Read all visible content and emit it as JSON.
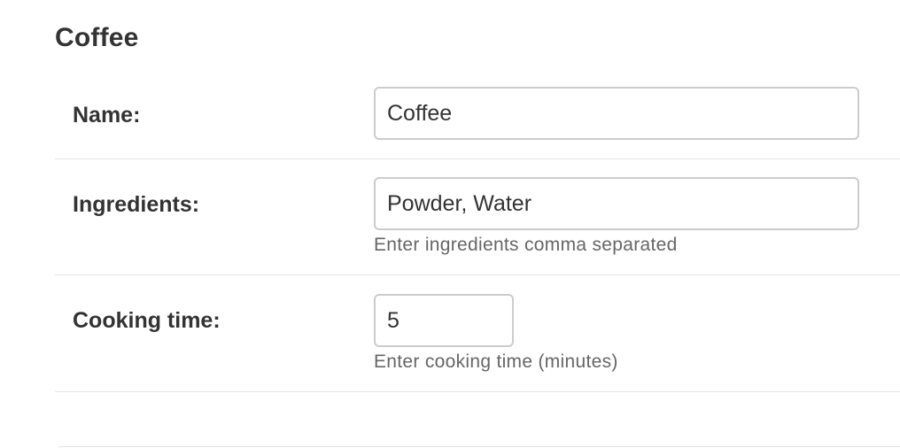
{
  "page": {
    "title": "Coffee"
  },
  "form": {
    "name": {
      "label": "Name:",
      "value": "Coffee"
    },
    "ingredients": {
      "label": "Ingredients:",
      "value": "Powder, Water",
      "help": "Enter ingredients comma separated"
    },
    "cooking_time": {
      "label": "Cooking time:",
      "value": "5",
      "help": "Enter cooking time (minutes)"
    }
  }
}
